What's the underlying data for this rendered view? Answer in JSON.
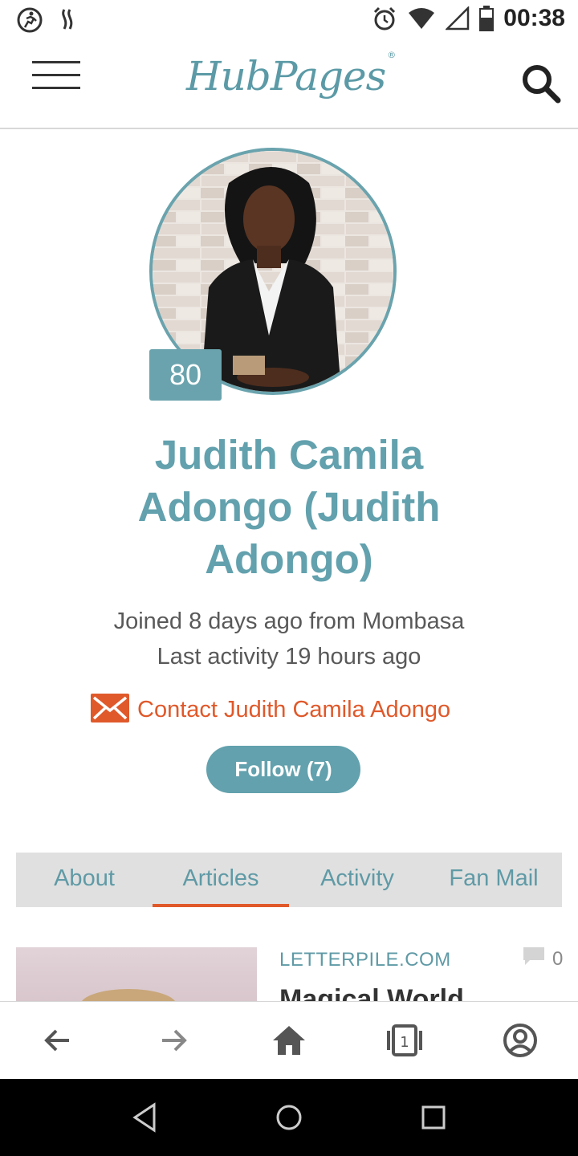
{
  "status_bar": {
    "time": "00:38",
    "icons": [
      "running-app-icon",
      "flame-app-icon",
      "alarm-icon",
      "wifi-icon",
      "signal-icon",
      "battery-icon"
    ]
  },
  "header": {
    "logo_text": "HubPages",
    "logo_mark": "®",
    "menu_icon": "hamburger-menu-icon",
    "search_icon": "search-icon"
  },
  "profile": {
    "score": "80",
    "name": "Judith Camila Adongo (Judith Adongo)",
    "joined": "Joined 8 days ago from Mombasa",
    "last_activity": "Last activity 19 hours ago",
    "contact_label": "Contact Judith Camila Adongo",
    "follow_label": "Follow (7)"
  },
  "tabs": [
    {
      "label": "About",
      "active": false
    },
    {
      "label": "Articles",
      "active": true
    },
    {
      "label": "Activity",
      "active": false
    },
    {
      "label": "Fan Mail",
      "active": false
    }
  ],
  "article": {
    "source": "LETTERPILE.COM",
    "comment_count": "0",
    "title": "Magical World"
  },
  "browser_bar": {
    "tab_count": "1",
    "icons": [
      "back-arrow-icon",
      "forward-arrow-icon",
      "home-icon",
      "tabs-icon",
      "account-icon"
    ]
  },
  "colors": {
    "brand_teal": "#62a1ad",
    "accent_orange": "#e0592a",
    "tab_bg": "#e0e0e0"
  }
}
